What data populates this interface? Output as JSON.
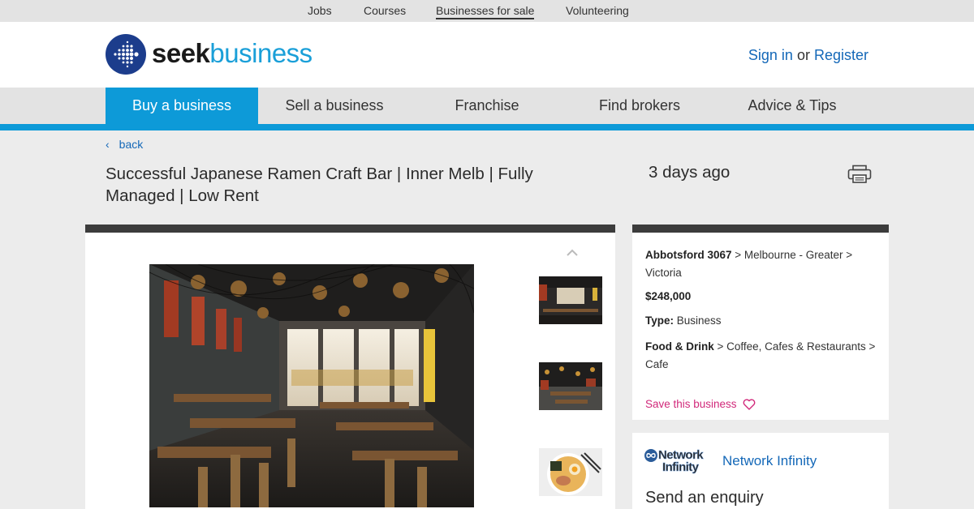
{
  "topbar": {
    "links": [
      "Jobs",
      "Courses",
      "Businesses for sale",
      "Volunteering"
    ]
  },
  "header": {
    "logo_word_1": "seek",
    "logo_word_2": "business",
    "sign_in": "Sign in",
    "or": "or",
    "register": "Register"
  },
  "nav": {
    "items": [
      "Buy a business",
      "Sell a business",
      "Franchise",
      "Find brokers",
      "Advice & Tips"
    ],
    "active_index": 0
  },
  "listing": {
    "back": "back",
    "title": "Successful Japanese Ramen Craft Bar | Inner Melb | Fully Managed | Low Rent",
    "age": "3 days ago",
    "location_bold": "Abbotsford 3067",
    "location_rest": " > Melbourne - Greater > Victoria",
    "price": "$248,000",
    "type_label": "Type:",
    "type_value": " Business",
    "category_bold": "Food & Drink",
    "category_rest": " > Coffee, Cafes & Restaurants > Cafe",
    "save": "Save this business"
  },
  "agent": {
    "logo_line1": "Network",
    "logo_line2": "Infinity",
    "name": "Network Infinity",
    "enquiry_heading": "Send an enquiry"
  },
  "colors": {
    "brand_blue": "#0d9ad8",
    "link_blue": "#1468b8",
    "save_pink": "#d1287a",
    "logo_navy": "#1c3d8c"
  },
  "icons": [
    "chevron-left-icon",
    "printer-icon",
    "chevron-up-icon",
    "heart-icon",
    "logo-globe-icon"
  ]
}
